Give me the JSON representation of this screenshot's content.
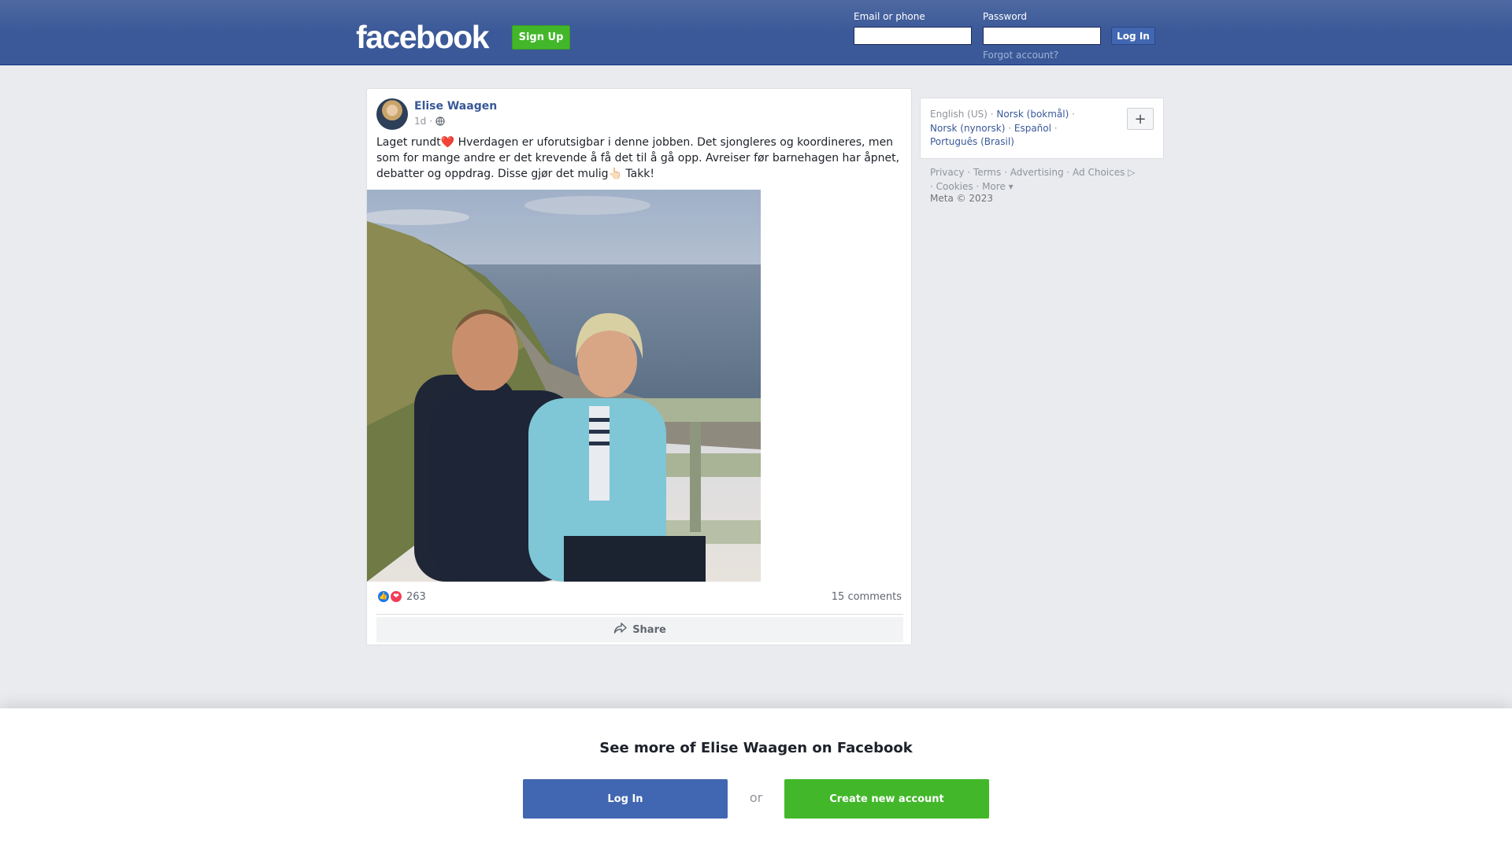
{
  "header": {
    "logo_text": "facebook",
    "signup_label": "Sign Up",
    "email_label": "Email or phone",
    "email_value": "",
    "password_label": "Password",
    "password_value": "",
    "login_label": "Log In",
    "forgot_label": "Forgot account?"
  },
  "post": {
    "author": "Elise Waagen",
    "time": "1d",
    "separator": "·",
    "visibility_icon": "globe-icon",
    "text": "Laget rundt❤️ Hverdagen er uforutsigbar i denne jobben. Det sjongleres og koordineres, men som for mange andre er det krevende å få det til å gå opp. Avreiser før barnehagen har åpnet, debatter og oppdrag. Disse gjør det mulig👆🏻 Takk!",
    "reaction_count": "263",
    "comments": "15 comments",
    "share_label": "Share"
  },
  "sidebar": {
    "languages": [
      "English (US)",
      "Norsk (bokmål)",
      "Norsk (nynorsk)",
      "Español",
      "Português (Brasil)"
    ],
    "add_language": "+",
    "footer_links": [
      "Privacy",
      "Terms",
      "Advertising",
      "Ad Choices",
      "Cookies",
      "More"
    ],
    "copyright": "Meta © 2023"
  },
  "bottom": {
    "title": "See more of Elise Waagen on Facebook",
    "login_label": "Log In",
    "or_label": "or",
    "create_label": "Create new account"
  },
  "colors": {
    "brand": "#3b5998",
    "link": "#385898",
    "signup_green": "#42b72a",
    "login_blue": "#4267b2"
  }
}
